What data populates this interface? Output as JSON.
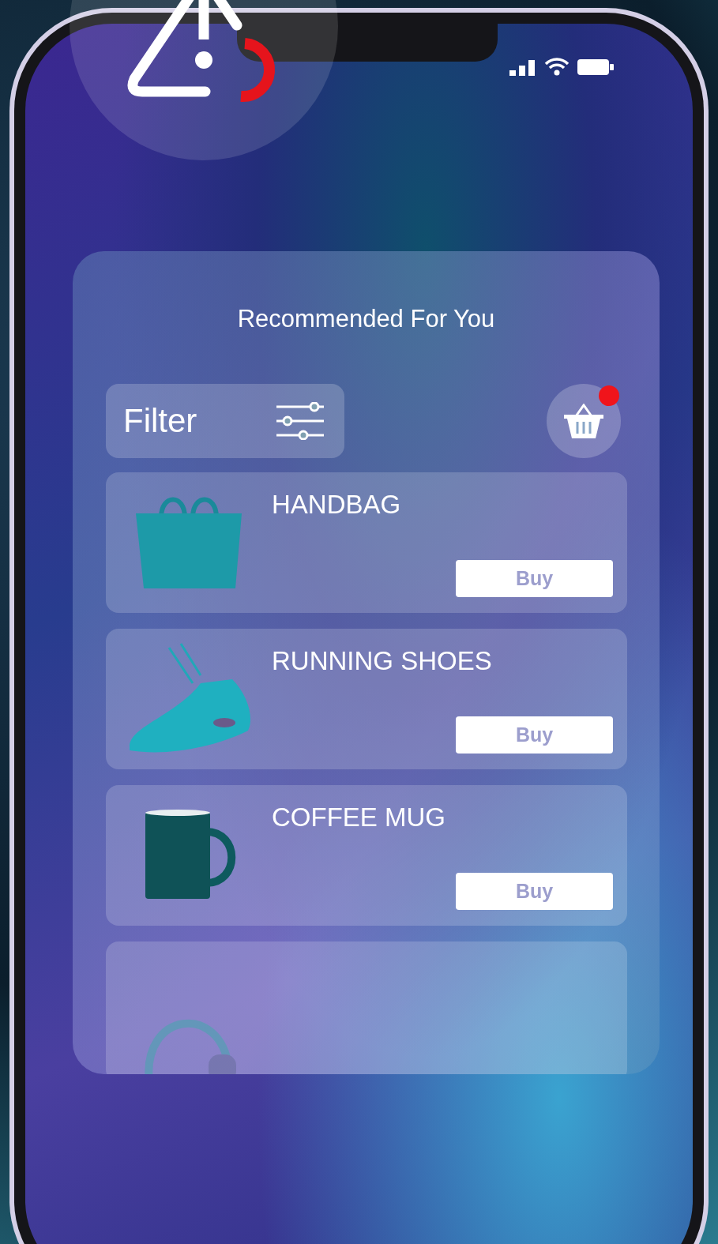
{
  "status_bar": {
    "signal": true,
    "wifi": true,
    "battery": true
  },
  "title": "Recommended For You",
  "filter": {
    "label": "Filter"
  },
  "cart": {
    "badge": true
  },
  "products": [
    {
      "kind": "handbag",
      "name": "HANDBAG",
      "button": "Buy"
    },
    {
      "kind": "shoe",
      "name": "RUNNING SHOES",
      "button": "Buy"
    },
    {
      "kind": "mug",
      "name": "COFFEE MUG",
      "button": "Buy"
    },
    {
      "kind": "headphones"
    }
  ]
}
